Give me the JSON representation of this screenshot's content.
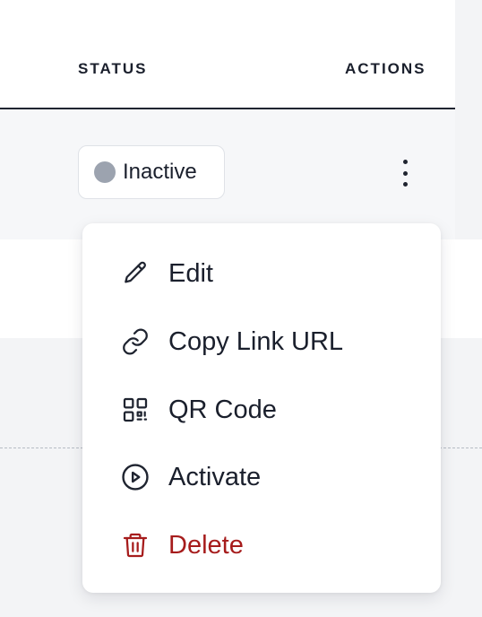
{
  "table": {
    "headers": {
      "status": "STATUS",
      "actions": "ACTIONS"
    },
    "row": {
      "status": "Inactive",
      "status_color": "#9ca3af"
    }
  },
  "menu": {
    "items": [
      {
        "label": "Edit",
        "icon": "pencil-icon"
      },
      {
        "label": "Copy Link URL",
        "icon": "link-icon"
      },
      {
        "label": "QR Code",
        "icon": "qr-code-icon"
      },
      {
        "label": "Activate",
        "icon": "play-circle-icon"
      },
      {
        "label": "Delete",
        "icon": "trash-icon",
        "color": "#a61c1c"
      }
    ]
  }
}
